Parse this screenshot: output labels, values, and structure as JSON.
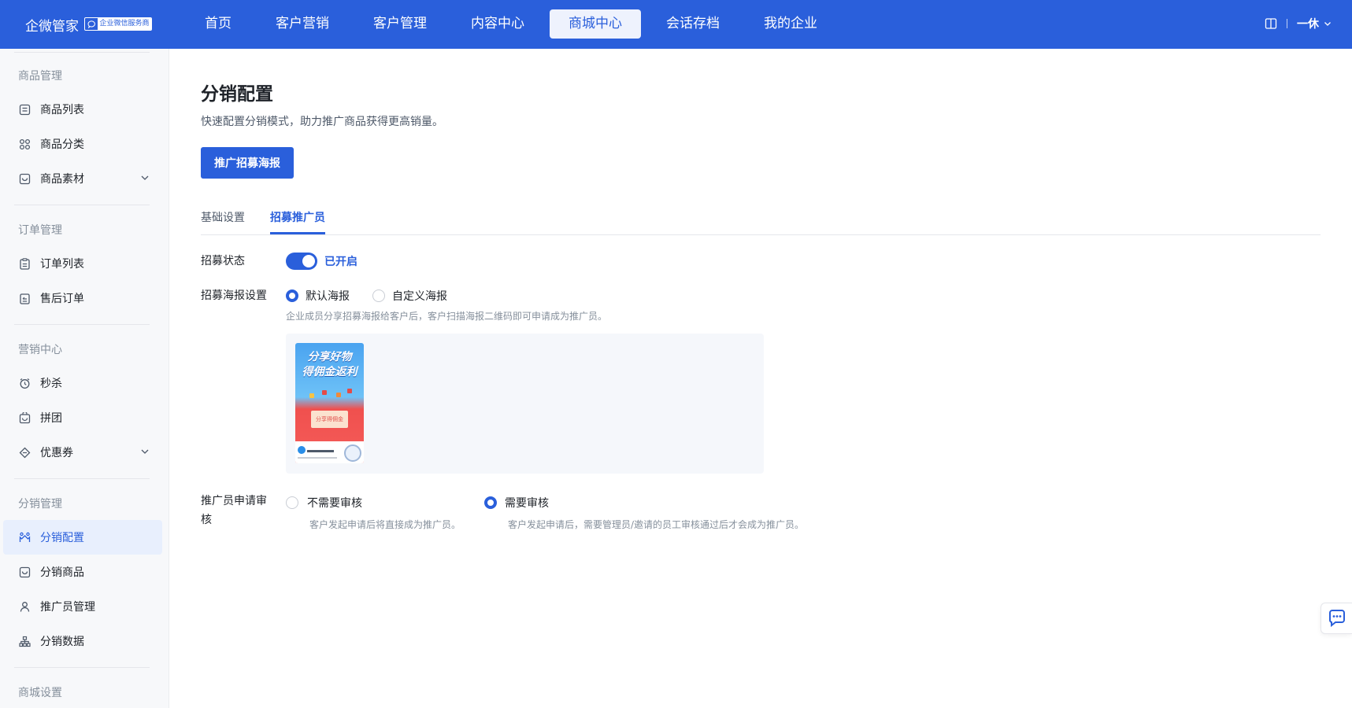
{
  "topbar": {
    "brand": "企微管家",
    "brand_badge": "企业微信服务商",
    "nav": [
      "首页",
      "客户营销",
      "客户管理",
      "内容中心",
      "商城中心",
      "会话存档",
      "我的企业"
    ],
    "active_nav": "商城中心",
    "user": "一休"
  },
  "sidebar": {
    "groups": [
      {
        "title": "商品管理",
        "items": [
          {
            "label": "商品列表",
            "icon": "list-icon"
          },
          {
            "label": "商品分类",
            "icon": "category-icon"
          },
          {
            "label": "商品素材",
            "icon": "material-icon",
            "expandable": true
          }
        ]
      },
      {
        "title": "订单管理",
        "items": [
          {
            "label": "订单列表",
            "icon": "order-icon"
          },
          {
            "label": "售后订单",
            "icon": "after-sale-icon"
          }
        ]
      },
      {
        "title": "营销中心",
        "items": [
          {
            "label": "秒杀",
            "icon": "alarm-clock-icon"
          },
          {
            "label": "拼团",
            "icon": "group-buy-icon"
          },
          {
            "label": "优惠券",
            "icon": "coupon-icon",
            "expandable": true
          }
        ]
      },
      {
        "title": "分销管理",
        "items": [
          {
            "label": "分销配置",
            "icon": "distribution-config-icon",
            "active": true
          },
          {
            "label": "分销商品",
            "icon": "distribution-goods-icon"
          },
          {
            "label": "推广员管理",
            "icon": "promoter-icon"
          },
          {
            "label": "分销数据",
            "icon": "data-tree-icon"
          }
        ]
      },
      {
        "title": "商城设置",
        "items": []
      }
    ]
  },
  "main": {
    "title": "分销配置",
    "description": "快速配置分销模式，助力推广商品获得更高销量。",
    "primary_button": "推广招募海报",
    "tabs": [
      "基础设置",
      "招募推广员"
    ],
    "active_tab": "招募推广员",
    "form": {
      "status_label": "招募状态",
      "status_on": true,
      "status_text": "已开启",
      "poster_label": "招募海报设置",
      "poster_options": [
        "默认海报",
        "自定义海报"
      ],
      "poster_selected": "默认海报",
      "poster_hint": "企业成员分享招募海报给客户后，客户扫描海报二维码即可申请成为推广员。",
      "poster_line1": "分享好物",
      "poster_line2": "得佣金返利",
      "poster_box_text": "分享得佣金",
      "review_label": "推广员申请审核",
      "review_options": [
        {
          "label": "不需要审核",
          "hint": "客户发起申请后将直接成为推广员。"
        },
        {
          "label": "需要审核",
          "hint": "客户发起申请后，需要管理员/邀请的员工审核通过后才会成为推广员。"
        }
      ],
      "review_selected": "需要审核"
    }
  },
  "colors": {
    "primary": "#2a5fdb",
    "sidebar_bg": "#f7f8fa"
  }
}
